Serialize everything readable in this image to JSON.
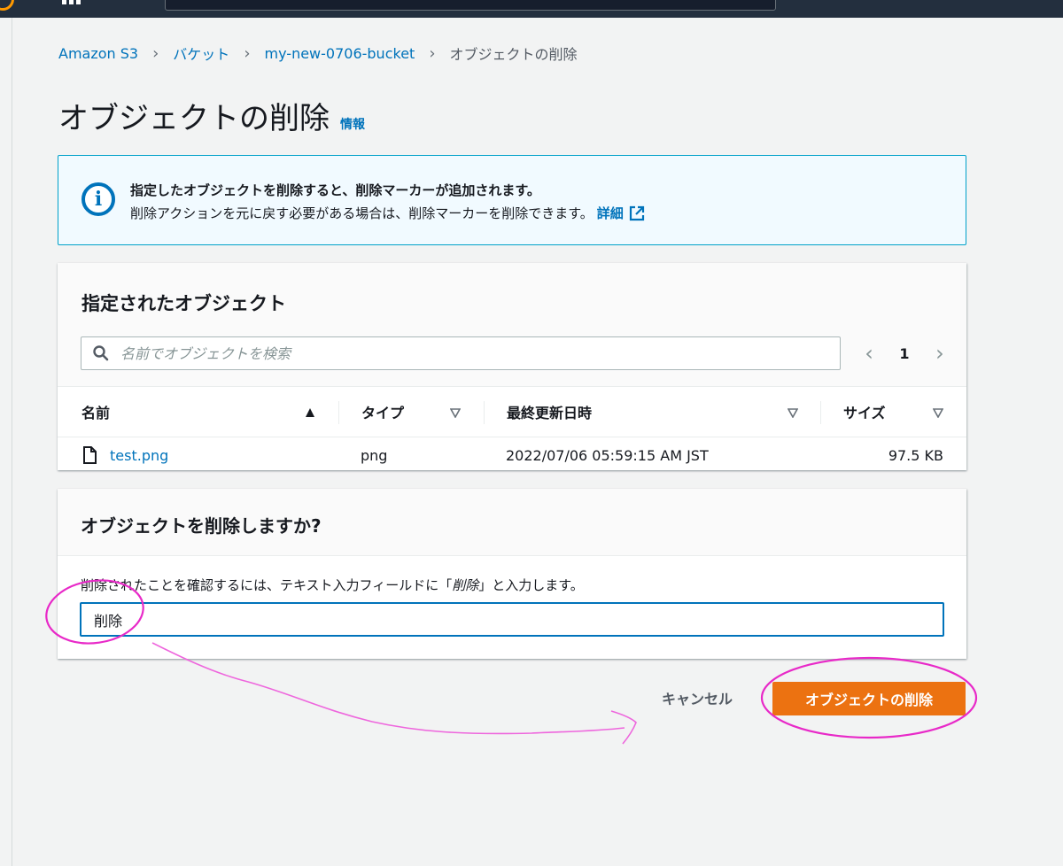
{
  "breadcrumb": {
    "items": [
      "Amazon S3",
      "バケット",
      "my-new-0706-bucket"
    ],
    "current": "オブジェクトの削除"
  },
  "page": {
    "title": "オブジェクトの削除",
    "info_label": "情報"
  },
  "alert": {
    "icon": "info-circle-icon",
    "title": "指定したオブジェクトを削除すると、削除マーカーが追加されます。",
    "body": "削除アクションを元に戻す必要がある場合は、削除マーカーを削除できます。",
    "link_label": "詳細"
  },
  "objects_panel": {
    "title": "指定されたオブジェクト",
    "search_placeholder": "名前でオブジェクトを検索",
    "page_number": "1",
    "columns": [
      "名前",
      "タイプ",
      "最終更新日時",
      "サイズ"
    ],
    "rows": [
      {
        "name": "test.png",
        "type": "png",
        "modified": "2022/07/06 05:59:15 AM JST",
        "size": "97.5 KB"
      }
    ]
  },
  "confirm_panel": {
    "title": "オブジェクトを削除しますか?",
    "label_before": "削除されたことを確認するには、テキスト入力フィールドに「",
    "label_keyword": "削除",
    "label_after": "」と入力します。",
    "input_value": "削除"
  },
  "actions": {
    "cancel_label": "キャンセル",
    "delete_label": "オブジェクトの削除"
  },
  "colors": {
    "accent": "#0073bb",
    "primary_button": "#ec7211",
    "annotation": "#e829c8"
  }
}
